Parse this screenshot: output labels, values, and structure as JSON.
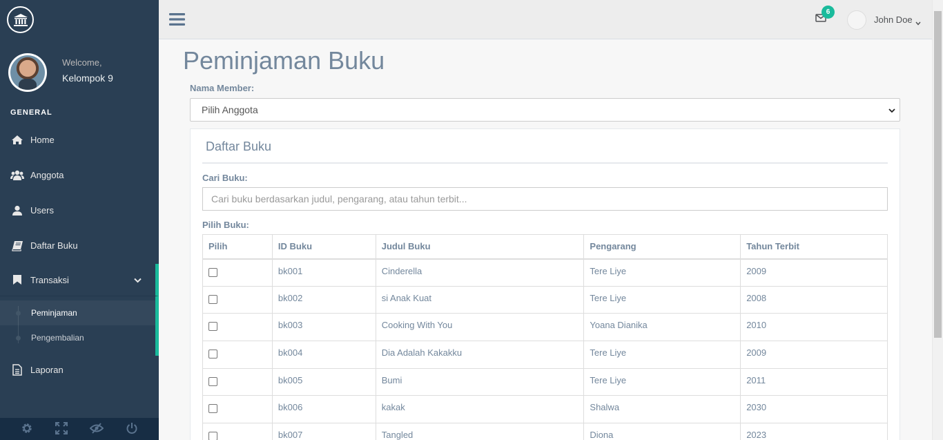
{
  "sidebar": {
    "welcome": "Welcome,",
    "user_name": "Kelompok 9",
    "section_title": "GENERAL",
    "items": [
      {
        "label": "Home",
        "icon": "home-icon"
      },
      {
        "label": "Anggota",
        "icon": "users-icon"
      },
      {
        "label": "Users",
        "icon": "user-icon"
      },
      {
        "label": "Daftar Buku",
        "icon": "book-icon"
      },
      {
        "label": "Transaksi",
        "icon": "bookmark-icon"
      },
      {
        "label": "Laporan",
        "icon": "file-icon"
      }
    ],
    "submenu": [
      {
        "label": "Peminjaman"
      },
      {
        "label": "Pengembalian"
      }
    ],
    "footer_icons": [
      "gear-icon",
      "fullscreen-icon",
      "eye-slash-icon",
      "power-icon"
    ]
  },
  "topnav": {
    "mail_count": "6",
    "user_name": "John Doe"
  },
  "main": {
    "title": "Peminjaman Buku",
    "member_label": "Nama Member:",
    "member_select_value": "Pilih Anggota",
    "panel_title": "Daftar Buku",
    "search_label": "Cari Buku:",
    "search_placeholder": "Cari buku berdasarkan judul, pengarang, atau tahun terbit...",
    "pick_label": "Pilih Buku:",
    "table": {
      "headers": [
        "Pilih",
        "ID Buku",
        "Judul Buku",
        "Pengarang",
        "Tahun Terbit"
      ],
      "rows": [
        {
          "id": "bk001",
          "title": "Cinderella",
          "author": "Tere Liye",
          "year": "2009"
        },
        {
          "id": "bk002",
          "title": "si Anak Kuat",
          "author": "Tere Liye",
          "year": "2008"
        },
        {
          "id": "bk003",
          "title": "Cooking With You",
          "author": "Yoana Dianika",
          "year": "2010"
        },
        {
          "id": "bk004",
          "title": "Dia Adalah Kakakku",
          "author": "Tere Liye",
          "year": "2009"
        },
        {
          "id": "bk005",
          "title": "Bumi",
          "author": "Tere Liye",
          "year": "2011"
        },
        {
          "id": "bk006",
          "title": "kakak",
          "author": "Shalwa",
          "year": "2030"
        },
        {
          "id": "bk007",
          "title": "Tangled",
          "author": "Diona",
          "year": "2023"
        }
      ]
    }
  },
  "colors": {
    "sidebar_bg": "#2A3F54",
    "accent": "#1ABB9C",
    "text": "#73879C"
  }
}
